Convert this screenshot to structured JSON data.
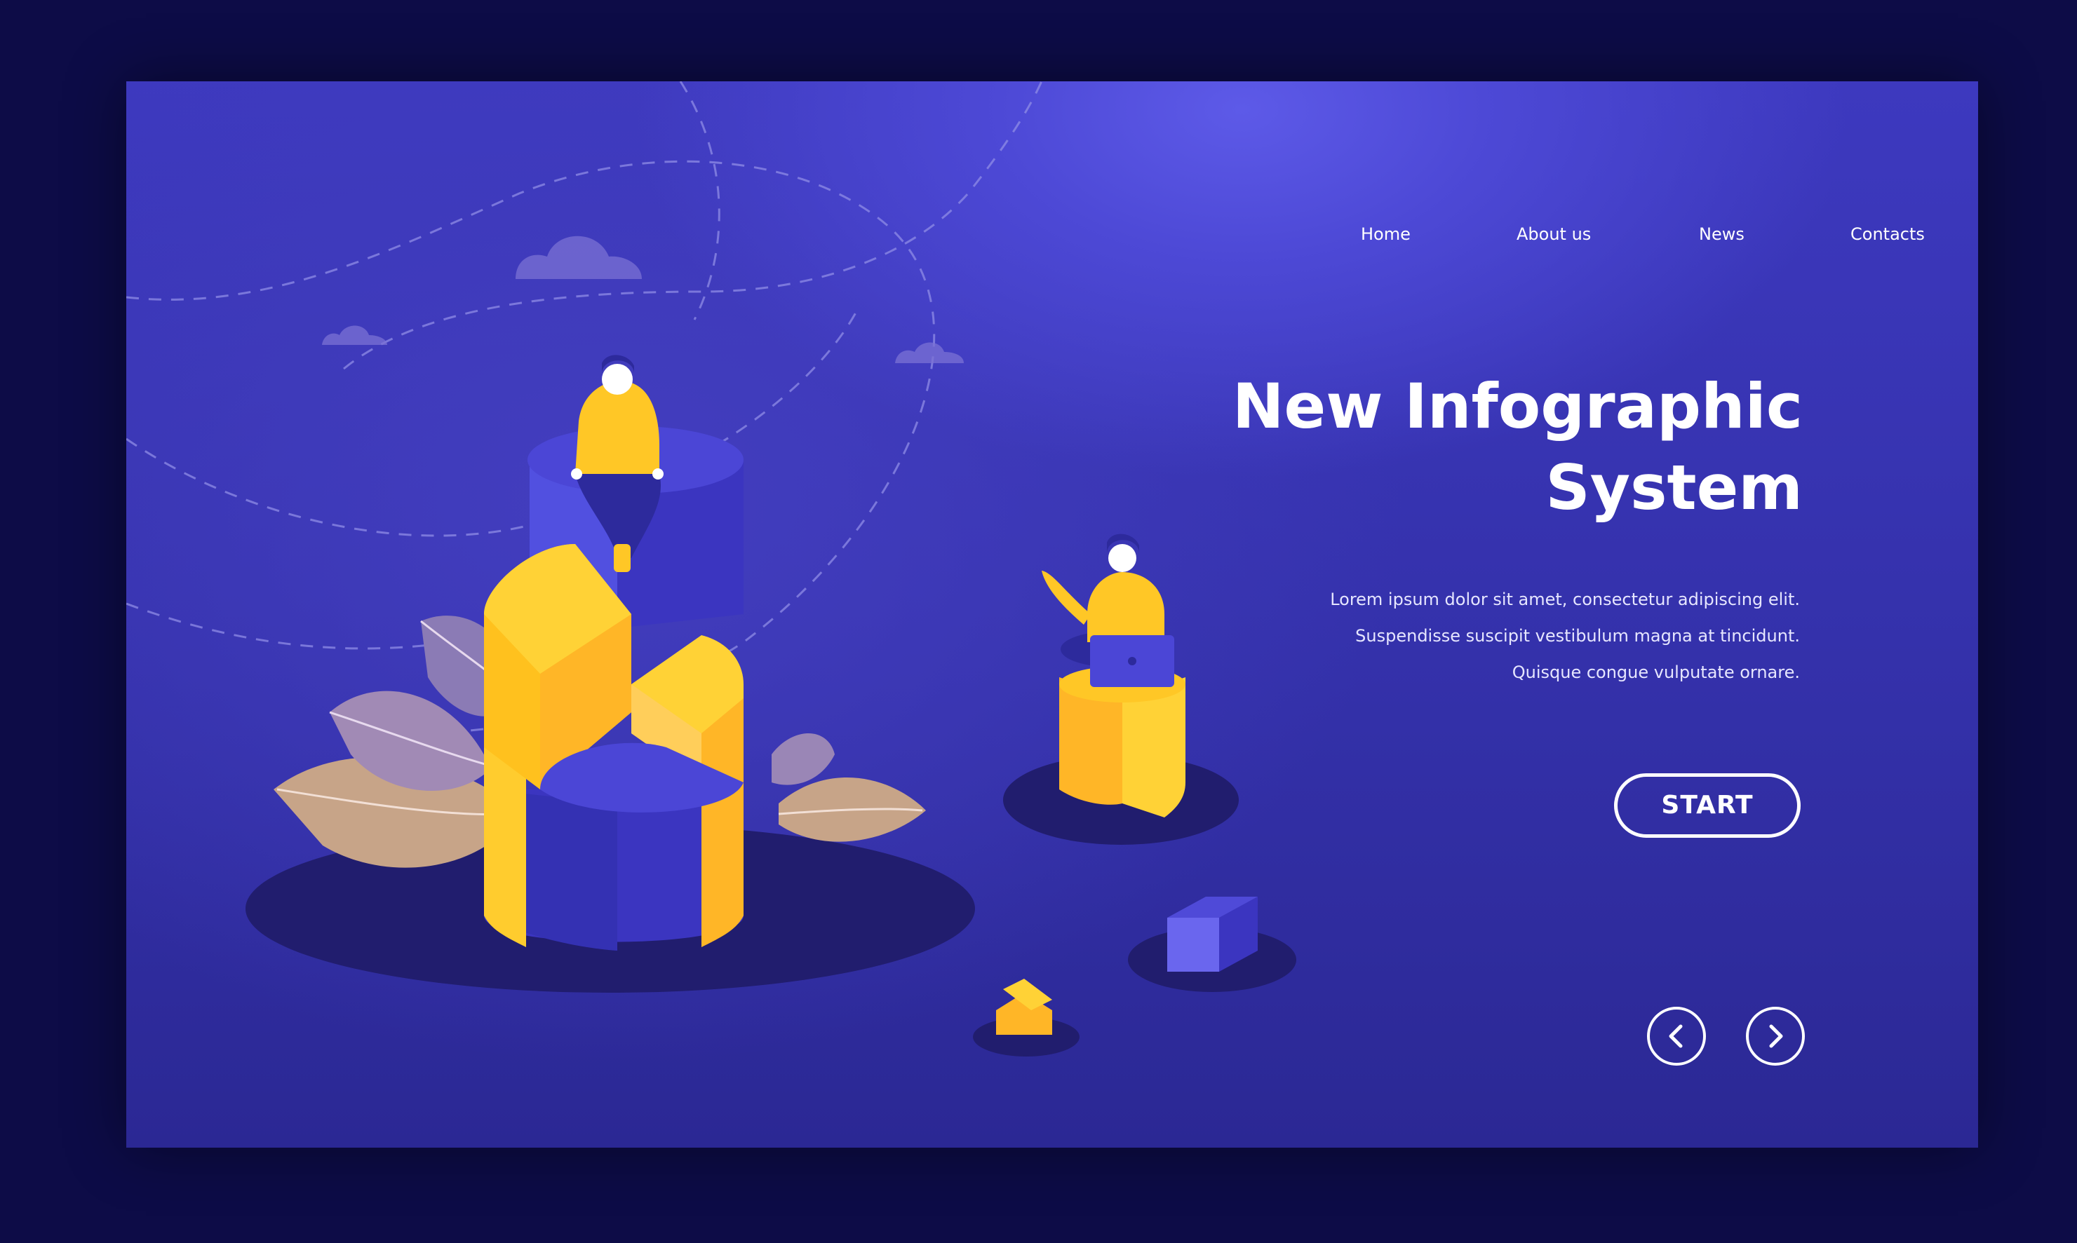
{
  "nav": {
    "items": [
      {
        "label": "Home"
      },
      {
        "label": "About us"
      },
      {
        "label": "News"
      },
      {
        "label": "Contacts"
      }
    ]
  },
  "hero": {
    "title_line1": "New Infographic",
    "title_line2": "System",
    "description": [
      "Lorem ipsum dolor sit amet, consectetur adipiscing elit.",
      "Suspendisse suscipit vestibulum magna at tincidunt.",
      "Quisque congue vulputate ornare."
    ],
    "start_label": "START"
  },
  "pager": {
    "prev_icon": "chevron-left-icon",
    "next_icon": "chevron-right-icon"
  },
  "colors": {
    "outer_background": "#0d0c47",
    "panel_background": "#3d39bf",
    "accent_yellow": "#ffc726",
    "accent_blue": "#4b46d6",
    "text": "#ffffff"
  }
}
